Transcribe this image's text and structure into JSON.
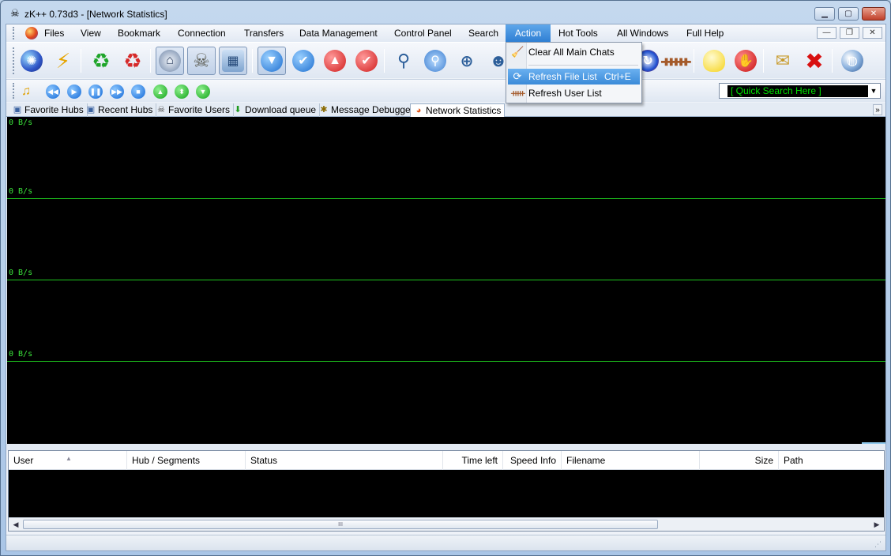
{
  "window": {
    "title": "zK++ 0.73d3  - [Network Statistics]",
    "app_icon": "skull-crossbones-icon",
    "controls": {
      "minimize": "▁",
      "maximize": "▢",
      "close": "✕"
    }
  },
  "menubar": {
    "items": [
      "Files",
      "View",
      "Bookmark",
      "Connection",
      "Transfers",
      "Data Management",
      "Control Panel",
      "Search",
      "Action",
      "Hot Tools",
      "All Windows",
      "Full Help"
    ],
    "active": "Action",
    "mdi_controls": {
      "minimize": "—",
      "restore": "❐",
      "close": "✕"
    }
  },
  "action_menu": {
    "items": [
      {
        "label": "Clear All Main Chats",
        "shortcut": "",
        "icon": "broom-icon"
      },
      {
        "label": "Refresh File List",
        "shortcut": "Ctrl+E",
        "icon": "refresh-file-list-icon",
        "highlighted": true
      },
      {
        "label": "Refresh User List",
        "shortcut": "",
        "icon": "users-icon"
      }
    ]
  },
  "toolbar": {
    "buttons": [
      "network-icon",
      "lightning-icon",
      "recycle-green-icon",
      "recycle-red-icon",
      "public-hubs-icon",
      "skull-icon",
      "cubes-icon",
      "download-icon",
      "checkmark-icon",
      "upload-icon",
      "checkmark-red-icon",
      "search-icon",
      "search-spy-icon",
      "zoom-in-icon",
      "user-icon",
      "refresh-icon",
      "users-group-icon",
      "lightbulb-icon",
      "stop-icon",
      "mail-icon",
      "close-x-icon",
      "settings-globe-icon"
    ]
  },
  "toolbar2": {
    "buttons": [
      "music-note-icon",
      "rewind-icon",
      "play-icon",
      "pause-icon",
      "fast-forward-icon",
      "stop-media-icon",
      "up-arrow-icon",
      "up-down-arrow-icon",
      "down-arrow-icon"
    ],
    "quick_search": {
      "value": "[ Quick Search Here ]"
    }
  },
  "tabs": [
    {
      "label": "Favorite Hubs",
      "icon": "favorite-hubs-icon"
    },
    {
      "label": "Recent Hubs",
      "icon": "recent-hubs-icon"
    },
    {
      "label": "Favorite Users",
      "icon": "favorite-users-icon"
    },
    {
      "label": "Download queue",
      "icon": "download-queue-icon"
    },
    {
      "label": "Message Debugger",
      "icon": "bug-icon"
    },
    {
      "label": "Network Statistics",
      "icon": "network-stats-icon",
      "active": true
    }
  ],
  "graph": {
    "rate_labels": [
      "0 B/s",
      "0 B/s",
      "0 B/s",
      "0 B/s"
    ],
    "line_color": "#1ec41e",
    "background": "#000000"
  },
  "transfer_list": {
    "columns": [
      "User",
      "Hub / Segments",
      "Status",
      "Time left",
      "Speed Info",
      "Filename",
      "Size",
      "Path"
    ],
    "rows": [],
    "scroll_thumb_label": "III"
  }
}
